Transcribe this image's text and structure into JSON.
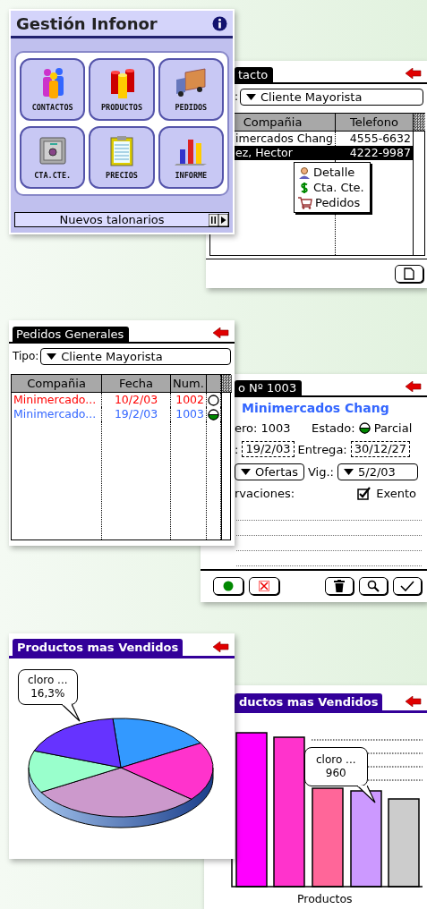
{
  "menu_window": {
    "title": "Gestión Infonor",
    "buttons": [
      {
        "label": "CONTACTOS",
        "kind": "people"
      },
      {
        "label": "PRODUCTOS",
        "kind": "products"
      },
      {
        "label": "PEDIDOS",
        "kind": "truck"
      },
      {
        "label": "CTA.CTE.",
        "kind": "safe"
      },
      {
        "label": "PRECIOS",
        "kind": "clipboard"
      },
      {
        "label": "INFORME",
        "kind": "chart"
      }
    ],
    "status": "Nuevos talonarios"
  },
  "contacts_window": {
    "title": "tacto",
    "filter_label": ":",
    "filter": "Cliente Mayorista",
    "columns": [
      "Compañia",
      "Telefono"
    ],
    "rows": [
      {
        "company": "imercados Chang",
        "phone": "4555-6632",
        "selected": false
      },
      {
        "company": "ez, Hector",
        "phone": "4222-9987",
        "selected": true
      }
    ],
    "popup_menu": [
      {
        "label": "Detalle",
        "kind": "person"
      },
      {
        "label": "Cta. Cte.",
        "kind": "dollar"
      },
      {
        "label": "Pedidos",
        "kind": "cart"
      }
    ]
  },
  "orders_window": {
    "title": "Pedidos Generales",
    "filter_label": "Tipo:",
    "filter": "Cliente Mayorista",
    "columns": [
      "Compañia",
      "Fecha",
      "Num."
    ],
    "rows": [
      {
        "company": "Minimercado...",
        "date": "10/2/03",
        "number": "1002",
        "color": "#ff0000",
        "partial": false
      },
      {
        "company": "Minimercado...",
        "date": "19/2/03",
        "number": "1003",
        "color": "#3366ff",
        "partial": true
      }
    ]
  },
  "order_window": {
    "title": "o Nº 1003",
    "company": "Minimercados Chang",
    "number_label": "ero: 1003",
    "status_label": "Estado:",
    "status_partial": true,
    "status_text": "Parcial",
    "date_label": ":",
    "date": "19/2/03",
    "delivery_label": "Entrega:",
    "delivery": "30/12/27",
    "list": "Ofertas",
    "validity_label": "Vig.:",
    "validity": "5/2/03",
    "notes_label": "rvaciones:",
    "exempt": {
      "label": "Exento",
      "checked": true
    }
  },
  "pie_window": {
    "title": "Productos mas Vendidos",
    "tooltip": [
      "cloro ...",
      "16,3%"
    ]
  },
  "bar_window": {
    "title": "ductos mas Vendidos",
    "tooltip": [
      "cloro ...",
      "960"
    ],
    "xlabel": "Productos"
  }
}
